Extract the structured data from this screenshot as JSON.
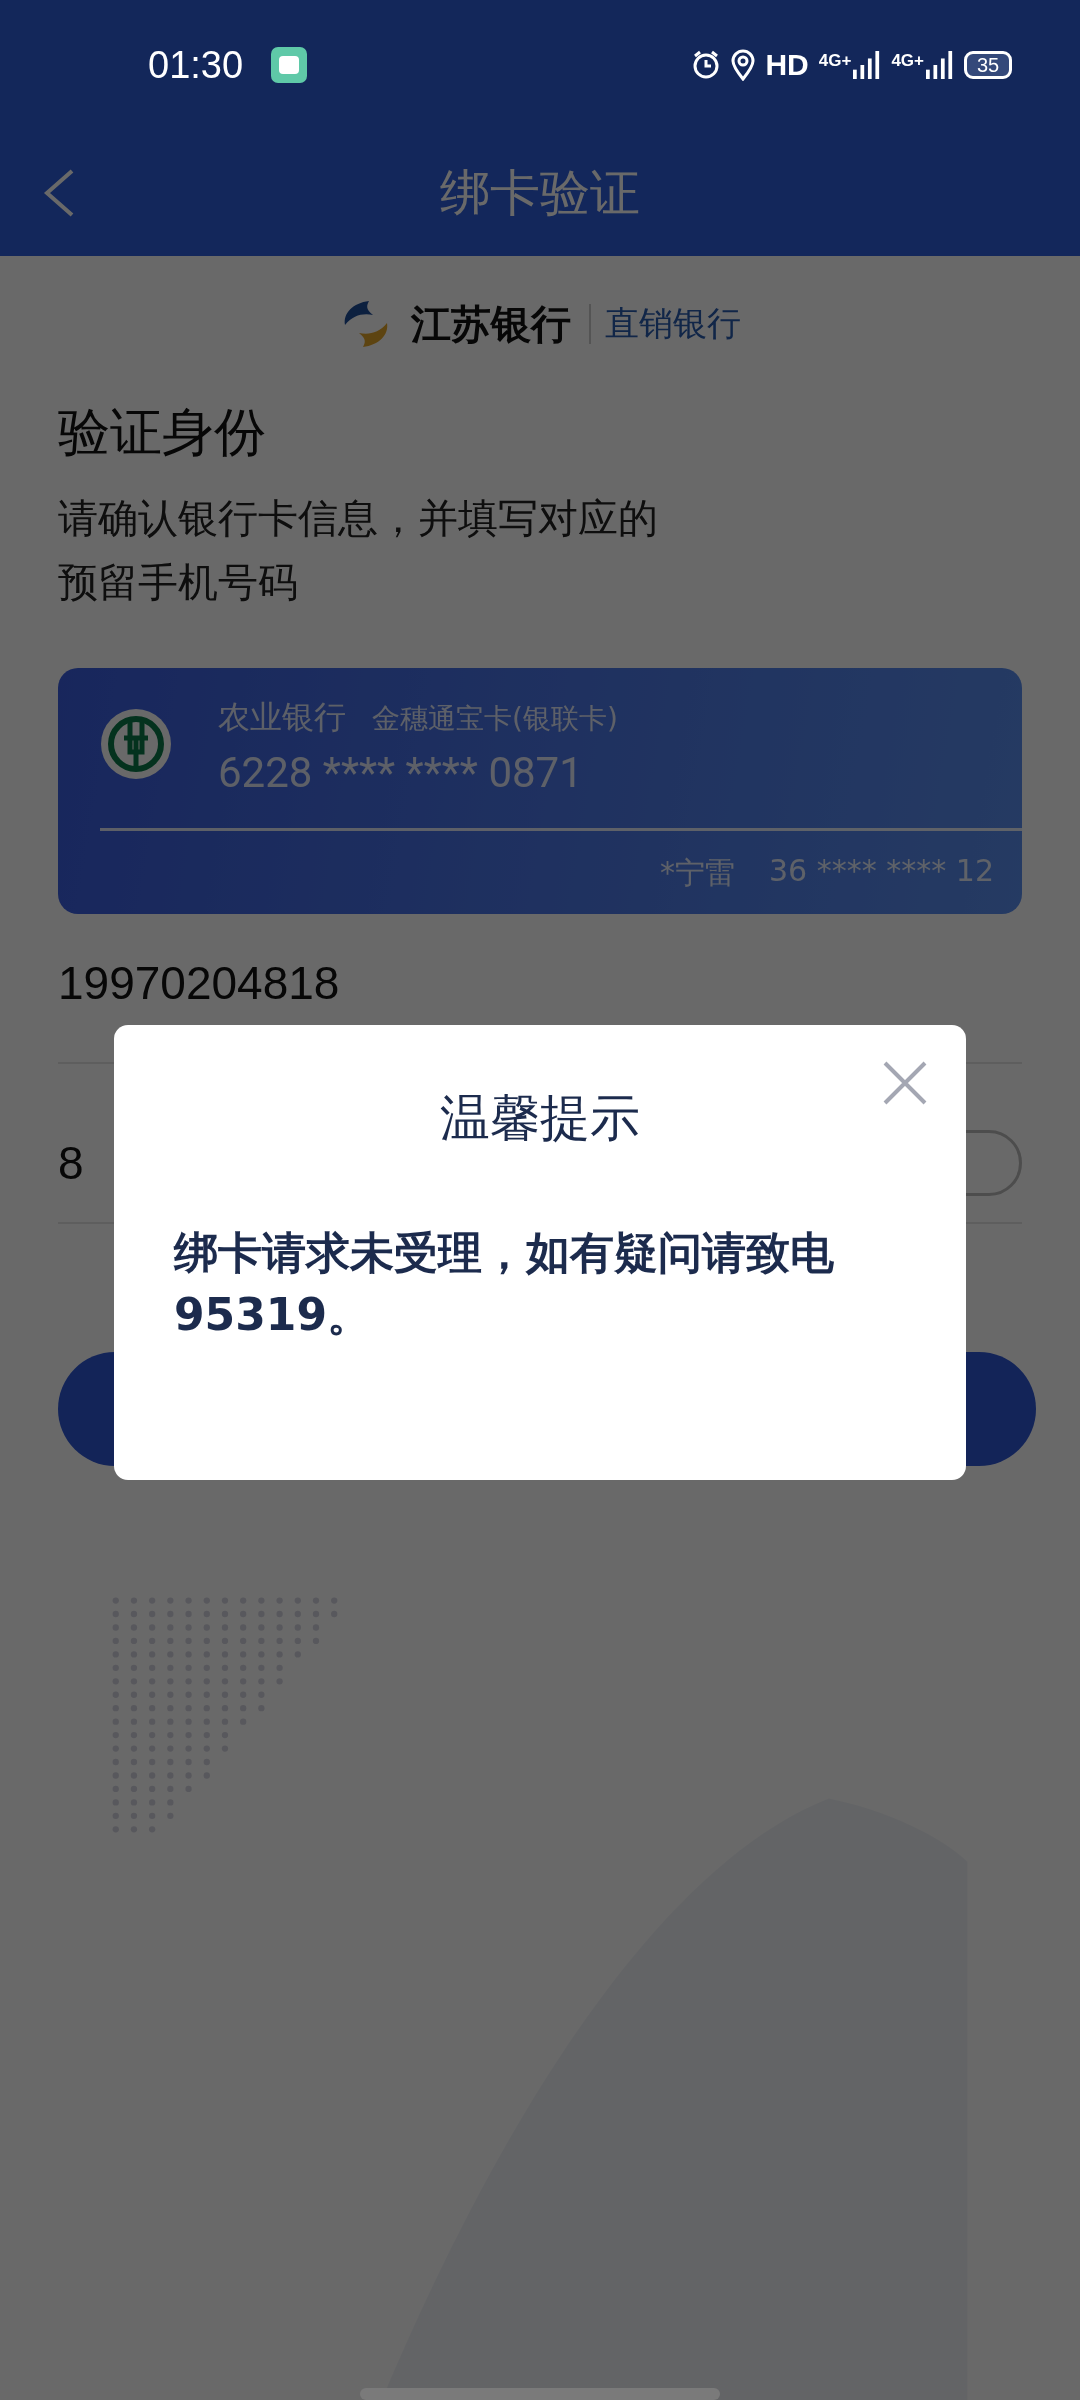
{
  "status_bar": {
    "time": "01:30",
    "hd": "HD",
    "networks": [
      "4G+",
      "4G+"
    ],
    "battery": "35"
  },
  "nav": {
    "title": "绑卡验证"
  },
  "brand": {
    "name": "江苏银行",
    "channel": "直销银行"
  },
  "heading": "验证身份",
  "subtitle": "请确认银行卡信息，并填写对应的预留手机号码",
  "card": {
    "bank": "农业银行",
    "card_type": "金穗通宝卡(银联卡)",
    "number": "6228 **** **** 0871",
    "holder": "*宁雷",
    "id_number": "36 **** **** 12"
  },
  "fields": [
    {
      "kind": "phone",
      "value": "19970204818"
    },
    {
      "kind": "code",
      "value": "8"
    }
  ],
  "dialog": {
    "title": "温馨提示",
    "message": "绑卡请求未受理，如有疑问请致电95319。"
  }
}
